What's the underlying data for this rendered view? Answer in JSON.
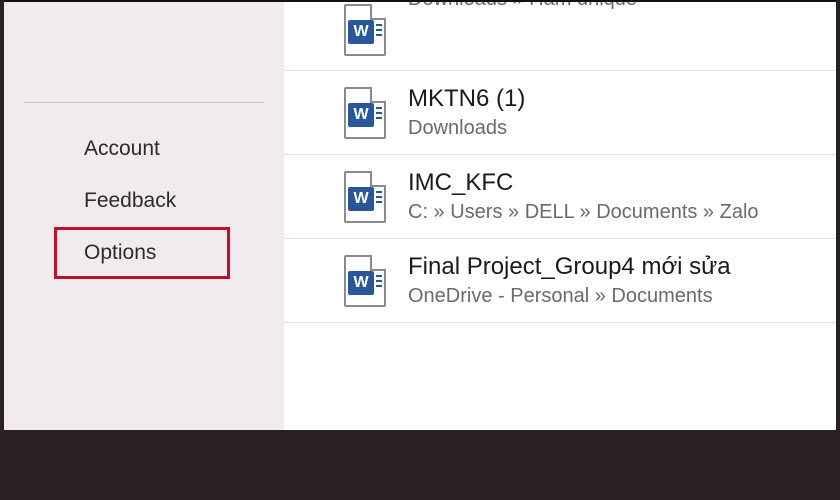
{
  "sidebar": {
    "items": [
      {
        "label": "Account"
      },
      {
        "label": "Feedback"
      },
      {
        "label": "Options"
      }
    ]
  },
  "documents": [
    {
      "title": "",
      "path": "Downloads » Hàm unique"
    },
    {
      "title": "MKTN6 (1)",
      "path": "Downloads"
    },
    {
      "title": "IMC_KFC",
      "path": "C: » Users » DELL » Documents » Zalo"
    },
    {
      "title": "Final Project_Group4 mới sửa",
      "path": "OneDrive - Personal » Documents"
    }
  ]
}
